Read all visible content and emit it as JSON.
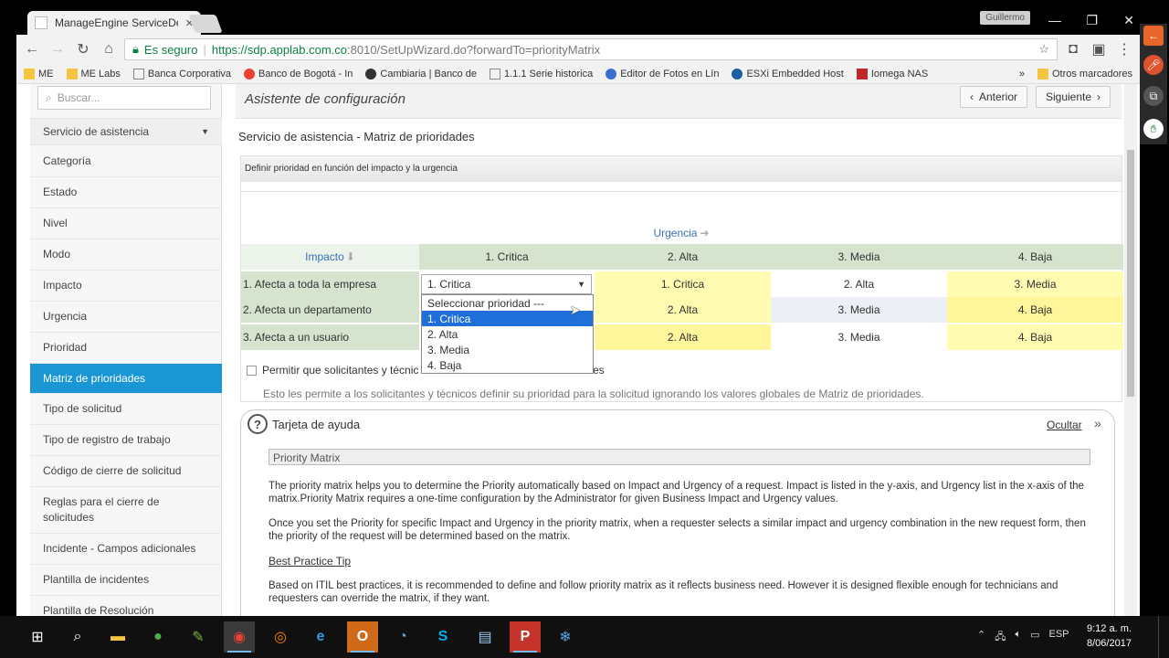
{
  "browser": {
    "tab_title": "ManageEngine ServiceDe",
    "tab_close": "✕",
    "user_chip": "Guillermo",
    "security_label": "Es seguro",
    "url_host": "https://sdp.applab.com.co",
    "url_rest": ":8010/SetUpWizard.do?forwardTo=priorityMatrix",
    "bookmarks": [
      "ME",
      "ME Labs",
      "Banca Corporativa",
      "Banco de Bogotá - In",
      "Cambiaria | Banco de",
      "1.1.1 Serie historica",
      "Editor de Fotos en Lín",
      "ESXi Embedded Host",
      "Iomega NAS"
    ],
    "bookmarks_more": "»",
    "other_bookmarks": "Otros marcadores"
  },
  "sidebar": {
    "search_placeholder": "Buscar...",
    "section": "Servicio de asistencia",
    "items": [
      "Categoría",
      "Estado",
      "Nivel",
      "Modo",
      "Impacto",
      "Urgencia",
      "Prioridad",
      "Matriz de prioridades",
      "Tipo de solicitud",
      "Tipo de registro de trabajo",
      "Código de cierre de solicitud",
      "Reglas para el cierre de solicitudes",
      "Incidente - Campos adicionales",
      "Plantilla de incidentes",
      "Plantilla de Resolución"
    ],
    "active_index": 7
  },
  "wizard": {
    "title": "Asistente de configuración",
    "prev_label": "Anterior",
    "next_label": "Siguiente"
  },
  "matrix": {
    "section_title": "Servicio de asistencia - Matriz de prioridades",
    "panel_header": "Definir prioridad en función del impacto y la urgencia",
    "urgency_label": "Urgencia",
    "impact_label": "Impacto",
    "columns": [
      "1. Critica",
      "2. Alta",
      "3. Media",
      "4. Baja"
    ],
    "rows": [
      {
        "label": "1. Afecta a toda la empresa",
        "values": [
          "1. Critica",
          "1. Critica",
          "2. Alta",
          "3. Media"
        ]
      },
      {
        "label": "2. Afecta un departamento",
        "values": [
          "",
          "2. Alta",
          "3. Media",
          "4. Baja"
        ]
      },
      {
        "label": "3. Afecta a un usuario",
        "values": [
          "",
          "2. Alta",
          "3. Media",
          "4. Baja"
        ]
      }
    ],
    "dropdown_options": [
      "Seleccionar prioridad ---",
      "1. Critica",
      "2. Alta",
      "3. Media",
      "4. Baja"
    ],
    "dropdown_selected": "1. Critica",
    "checkbox_label_start": "Permitir que solicitantes y técnic",
    "checkbox_label_end": "des",
    "note": "Esto les permite a los solicitantes y técnicos definir su prioridad para la solicitud ignorando los valores globales de Matriz de prioridades."
  },
  "help": {
    "title": "Tarjeta de ayuda",
    "hide": "Ocultar",
    "box_title": "Priority Matrix",
    "p1": "The priority matrix helps you to determine the Priority automatically based on Impact and Urgency of a request. Impact is listed in the y-axis, and Urgency list in the x-axis of the matrix.Priority Matrix requires a one-time configuration by the Administrator for given Business Impact and Urgency values.",
    "p2": "Once you set the Priority for specific Impact and Urgency in the priority matrix, when a requester selects a similar impact and urgency combination in the new request form, then the priority of the request will be determined based on the matrix.",
    "tip_title": "Best Practice Tip",
    "p3": "Based on ITIL best practices, it is recommended to define and follow priority matrix as it reflects business need. However it is designed flexible enough for technicians and requesters can override the matrix, if they want."
  },
  "taskbar": {
    "lang": "ESP",
    "time": "9:12 a. m.",
    "date": "8/06/2017"
  }
}
